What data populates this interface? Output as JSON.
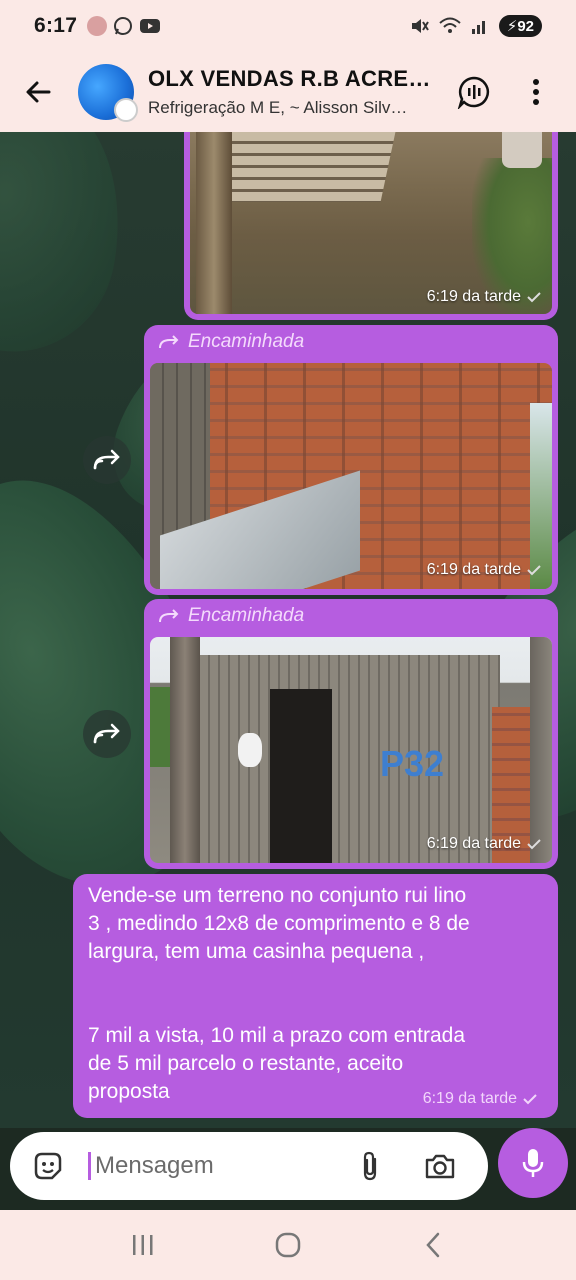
{
  "status_bar": {
    "time": "6:17",
    "battery": "92",
    "icons": [
      "avatar-icon",
      "whatsapp-icon",
      "youtube-icon",
      "mute-icon",
      "wifi-icon",
      "signal-icon",
      "battery-icon"
    ]
  },
  "header": {
    "title": "OLX VENDAS R.B ACRE…",
    "members": "Refrigeração M E, ~ Alisson Silv…",
    "icons": [
      "back-arrow-icon",
      "group-avatar",
      "voice-chat-icon",
      "more-vert-icon"
    ]
  },
  "messages": [
    {
      "type": "image",
      "forwarded": false,
      "time": "6:19 da tarde",
      "scene": "wooden pallet on dirt ground"
    },
    {
      "type": "image",
      "forwarded": true,
      "forwarded_label": "Encaminhada",
      "time": "6:19 da tarde",
      "scene": "orange brick wall with wooden door"
    },
    {
      "type": "image",
      "forwarded": true,
      "forwarded_label": "Encaminhada",
      "time": "6:19 da tarde",
      "scene": "wooden shack with dark doorway"
    },
    {
      "type": "text",
      "forwarded": false,
      "lines": [
        "Vende-se um terreno no conjunto rui lino",
        "3 , medindo 12x8 de comprimento e 8 de",
        "largura, tem uma casinha pequena ,",
        "",
        "",
        "7 mil a vista, 10 mil a prazo com entrada",
        "de 5 mil parcelo o restante, aceito",
        "proposta"
      ],
      "time": "6:19 da tarde"
    }
  ],
  "input": {
    "placeholder": "Mensagem",
    "icons": [
      "sticker-icon",
      "attach-icon",
      "camera-icon",
      "mic-icon"
    ]
  },
  "nav": {
    "icons": [
      "recent-apps-icon",
      "home-icon",
      "back-icon"
    ]
  },
  "colors": {
    "accent": "#b65de0",
    "header_bg": "#fbe9e6",
    "chat_bg": "#273b31"
  }
}
